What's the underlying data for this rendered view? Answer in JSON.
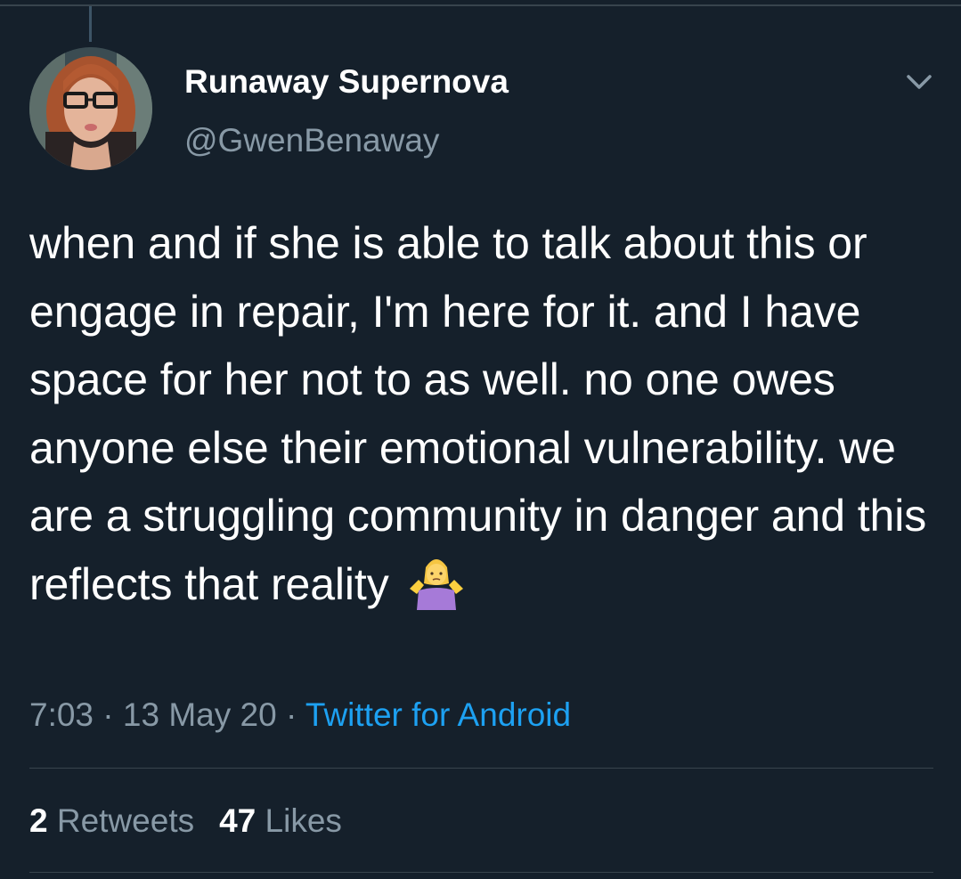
{
  "author": {
    "display_name": "Runaway Supernova",
    "handle": "@GwenBenaway",
    "avatar_icon": "profile-photo"
  },
  "menu_icon": "chevron-down-icon",
  "tweet": {
    "text": "when and if she is able to talk about this or engage in repair, I'm here for it. and I have space for her not to as well. no one owes anyone else their emotional vulnerability. we are a struggling community in danger and this reflects that reality",
    "emoji": "person-shrugging-emoji"
  },
  "meta": {
    "time": "7:03",
    "separator": " · ",
    "date": "13 May 20",
    "source": "Twitter for Android"
  },
  "stats": {
    "retweets_count": "2",
    "retweets_label": "Retweets",
    "likes_count": "47",
    "likes_label": "Likes"
  },
  "colors": {
    "background": "#15202b",
    "text": "#ffffff",
    "secondary_text": "#8899a6",
    "link": "#1da1f2",
    "divider": "#38444d"
  }
}
